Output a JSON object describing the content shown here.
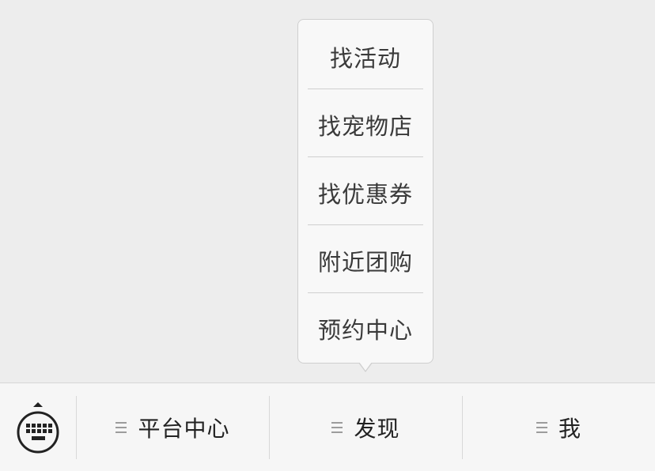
{
  "popup_menu": {
    "items": [
      {
        "label": "找活动"
      },
      {
        "label": "找宠物店"
      },
      {
        "label": "找优惠券"
      },
      {
        "label": "附近团购"
      },
      {
        "label": "预约中心"
      }
    ]
  },
  "toolbar": {
    "keyboard_icon": "keyboard-toggle-icon",
    "tabs": [
      {
        "label": "平台中心",
        "icon": "menu-list-icon"
      },
      {
        "label": "发现",
        "icon": "menu-list-icon"
      },
      {
        "label": "我",
        "icon": "menu-list-icon"
      }
    ]
  },
  "colors": {
    "background": "#ededed",
    "popup_bg": "#f8f8f8",
    "toolbar_bg": "#f6f6f6",
    "text_primary": "#222222",
    "text_menu": "#3a3a3a",
    "divider": "#cfcfcf"
  }
}
